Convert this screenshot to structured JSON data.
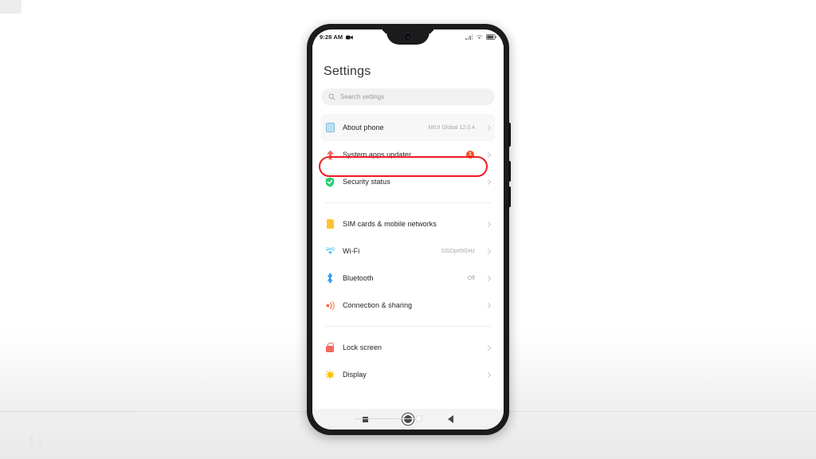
{
  "phone": {
    "status_bar": {
      "time": "9:28 AM",
      "recording_icon": "video-camera-icon",
      "signal_icon": "signal-bars-icon",
      "wifi_icon": "wifi-icon",
      "battery_icon": "battery-icon"
    },
    "header": {
      "title": "Settings"
    },
    "search": {
      "placeholder": "Search settings",
      "icon": "search-icon"
    },
    "groups": [
      {
        "rows": [
          {
            "label": "About phone",
            "value": "MIUI Global 12.0.4",
            "icon": "phone-info-icon",
            "highlighted": true,
            "annotated": true
          },
          {
            "label": "System apps updater",
            "value": "",
            "badge": "1",
            "icon": "arrow-up-update-icon"
          },
          {
            "label": "Security status",
            "value": "",
            "icon": "shield-check-icon"
          }
        ]
      },
      {
        "rows": [
          {
            "label": "SIM cards & mobile networks",
            "value": "",
            "icon": "sim-card-icon"
          },
          {
            "label": "Wi-Fi",
            "value": "SSIDprt5GHz",
            "icon": "wifi-icon"
          },
          {
            "label": "Bluetooth",
            "value": "Off",
            "icon": "bluetooth-icon"
          },
          {
            "label": "Connection & sharing",
            "value": "",
            "icon": "connection-sharing-icon"
          }
        ]
      },
      {
        "rows": [
          {
            "label": "Lock screen",
            "value": "",
            "icon": "lock-icon"
          },
          {
            "label": "Display",
            "value": "",
            "icon": "brightness-sun-icon"
          }
        ]
      }
    ],
    "nav_bar": {
      "recents": "recents-square-icon",
      "home": "home-circle-icon",
      "back": "back-triangle-icon"
    }
  },
  "colors": {
    "annotation": "#ee1c25",
    "badge": "#f4511e",
    "about_icon": "#bfe0f2",
    "update_icon": "#f2675e",
    "security_icon": "#2ecc71",
    "sim_icon": "#ffc233",
    "wifi_icon": "#4fc3f7",
    "bluetooth_icon": "#2196f3",
    "connection_icon": "#ff7043",
    "lock_icon": "#f2675e",
    "display_icon": "#ffc107"
  }
}
